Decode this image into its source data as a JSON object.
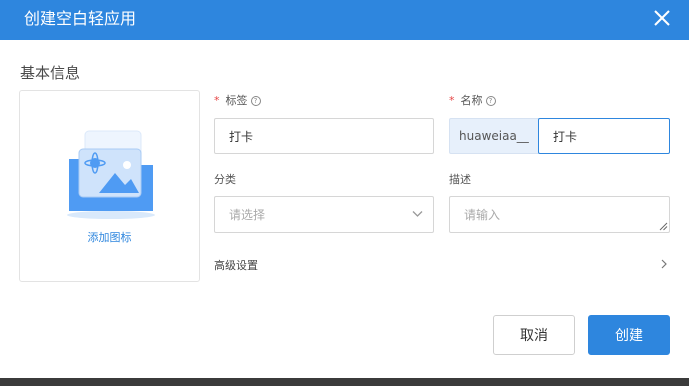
{
  "dialog": {
    "title": "创建空白轻应用",
    "close_icon": "close-icon"
  },
  "basic_info": {
    "section_title": "基本信息",
    "icon_upload": {
      "label": "添加图标",
      "icon": "image-folder-icon"
    }
  },
  "form": {
    "tag": {
      "required_mark": "*",
      "label": "标签",
      "help_icon": "help-icon",
      "value": "打卡"
    },
    "name": {
      "required_mark": "*",
      "label": "名称",
      "help_icon": "help-icon",
      "prefix": "huaweiaa__",
      "value": "打卡"
    },
    "category": {
      "label": "分类",
      "placeholder": "请选择",
      "icon": "chevron-down-icon"
    },
    "description": {
      "label": "描述",
      "placeholder": "请输入"
    },
    "advanced": {
      "label": "高级设置",
      "icon": "chevron-right-icon"
    }
  },
  "footer": {
    "cancel_label": "取消",
    "create_label": "创建"
  },
  "colors": {
    "accent": "#2e86de",
    "required": "#e64545"
  }
}
